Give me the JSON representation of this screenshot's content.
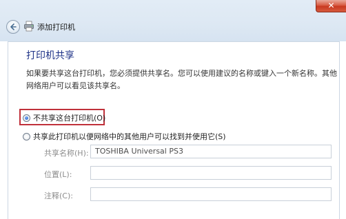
{
  "window": {
    "title": "添加打印机",
    "close_glyph": "✕"
  },
  "page": {
    "heading": "打印机共享",
    "description": "如果要共享这台打印机，您必须提供共享名。您可以使用建议的名称或键入一个新名称。其他网络用户可以看见该共享名。"
  },
  "options": [
    {
      "label": "不共享这台打印机(O)",
      "checked": true
    },
    {
      "label": "共享此打印机以便网络中的其他用户可以找到并使用它(S)",
      "checked": false
    }
  ],
  "fields": {
    "share_name": {
      "label": "共享名称(H):",
      "value": "TOSHIBA Universal PS3"
    },
    "location": {
      "label": "位置(L):",
      "value": ""
    },
    "comment": {
      "label": "注释(C):",
      "value": ""
    }
  },
  "colors": {
    "heading": "#1e3287",
    "highlight": "#c0303a",
    "titlebar": "#dde8f3"
  },
  "icons": [
    "back-arrow-icon",
    "printer-icon",
    "close-icon"
  ]
}
